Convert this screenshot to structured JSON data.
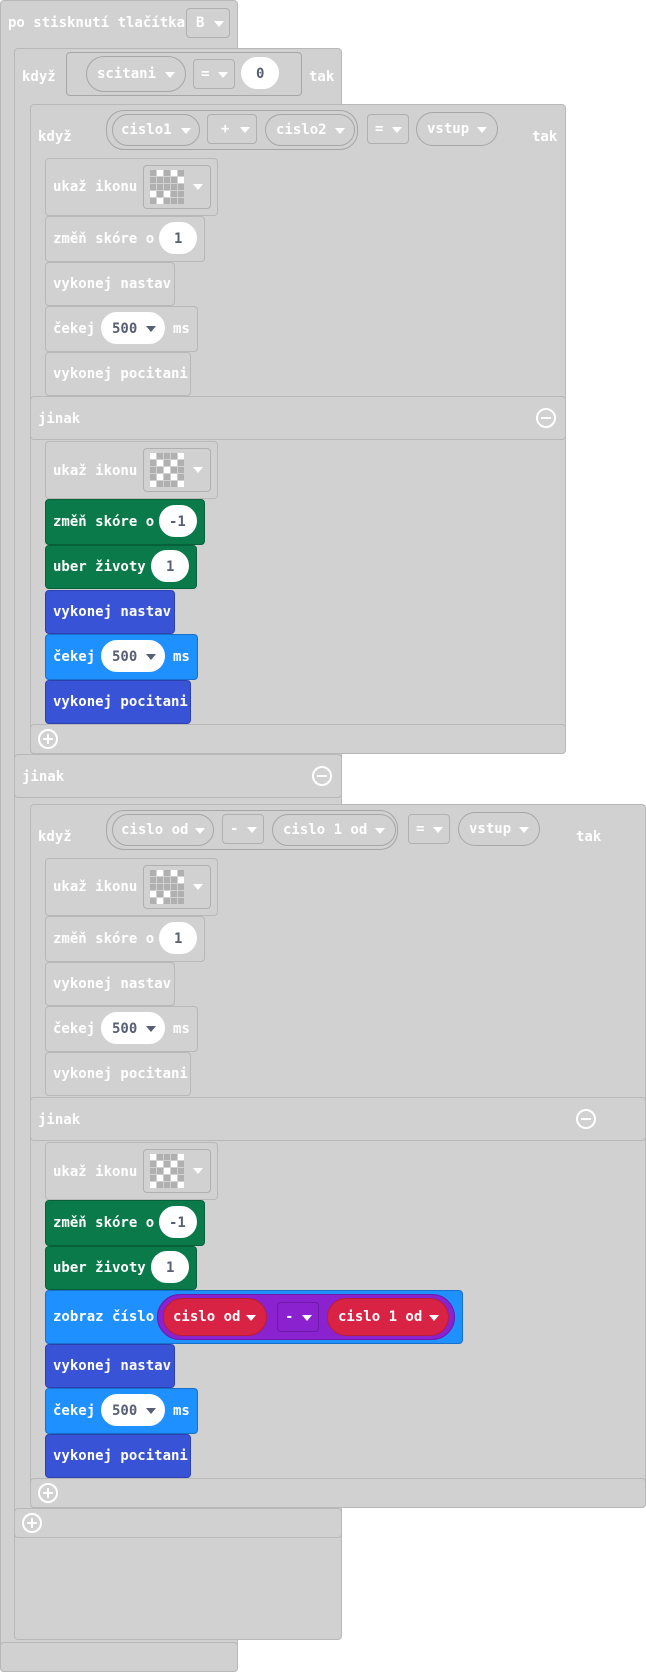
{
  "event": {
    "label": "po stisknutí tlačítka",
    "button": "B"
  },
  "if1": {
    "kdyz": "když",
    "var": "scitani",
    "op": "=",
    "val": "0",
    "tak": "tak"
  },
  "if2": {
    "kdyz": "když",
    "a": "cislo1",
    "plus": "+",
    "b": "cislo2",
    "op": "=",
    "c": "vstup",
    "tak": "tak"
  },
  "if3": {
    "kdyz": "když",
    "a": "cislo od",
    "minus": "-",
    "b": "cislo 1 od",
    "op": "=",
    "c": "vstup",
    "tak": "tak"
  },
  "labels": {
    "show_icon": "ukaž ikonu",
    "change_score": "změň skóre o",
    "lose_life": "uber životy",
    "call_nastav": "vykonej nastav",
    "wait": "čekej",
    "ms": "ms",
    "call_pocitani": "vykonej pocitani",
    "else": "jinak",
    "show_number": "zobraz číslo"
  },
  "values": {
    "plus_one": "1",
    "minus_one": "-1",
    "one": "1",
    "wait_ms": "500"
  },
  "show_number": {
    "a": "cislo od",
    "op": "-",
    "b": "cislo 1 od"
  },
  "colors": {
    "gray": "#d1d1d1",
    "green": "#0b7a4b",
    "navy": "#3853d6",
    "sky": "#1e90ff",
    "red": "#d92344",
    "purple": "#8a22d0"
  }
}
